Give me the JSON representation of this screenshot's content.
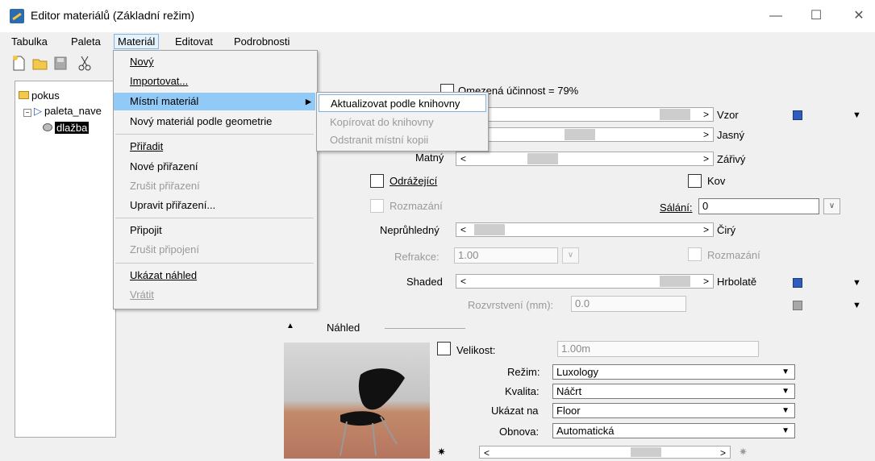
{
  "window": {
    "title": "Editor materiálů (Základní režim)",
    "minimize": "—",
    "maximize": "☐",
    "close": "✕"
  },
  "menubar": [
    "Tabulka",
    "Paleta",
    "Materiál",
    "Editovat",
    "Podrobnosti"
  ],
  "tree": {
    "root": "pokus",
    "palette": "paleta_nave",
    "material": "dlažba"
  },
  "material_menu": {
    "items": [
      "Nový",
      "Importovat...",
      "Místní materiál",
      "Nový materiál podle geometrie",
      "Přiřadit",
      "Nové přiřazení",
      "Zrušit přiřazení",
      "Upravit přiřazení...",
      "Připojit",
      "Zrušit připojení",
      "Ukázat náhled",
      "Vrátit"
    ],
    "disabled": [
      "Zrušit přiřazení",
      "Zrušit připojení",
      "Vrátit"
    ]
  },
  "submenu": {
    "items": [
      "Aktualizovat podle knihovny",
      "Kopírovat do knihovny",
      "Odstranit místní kopii"
    ]
  },
  "props": {
    "efficiency_label": "Omezená účinnost = 79%",
    "vzor": "Vzor",
    "jasny": "Jasný",
    "matny": "Matný",
    "zarivy": "Zářivý",
    "odrazejici": "Odrážející",
    "kov": "Kov",
    "rozmazani": "Rozmazání",
    "salani_label": "Sálání:",
    "salani_value": "0",
    "nepruhledny": "Neprůhledný",
    "ciry": "Čirý",
    "refrakce_label": "Refrakce:",
    "refrakce_value": "1.00",
    "rozmazani2": "Rozmazání",
    "shaded": "Shaded",
    "hrbolate": "Hrbolatě",
    "rozvrstveni_label": "Rozvrstvení (mm):",
    "rozvrstveni_value": "0.0",
    "lt": "<",
    "gt": ">"
  },
  "preview": {
    "title": "Náhled",
    "velikost_label": "Velikost:",
    "velikost_value": "1.00m",
    "rezim_label": "Režim:",
    "rezim_value": "Luxology",
    "kvalita_label": "Kvalita:",
    "kvalita_value": "Náčrt",
    "ukazat_label": "Ukázat na",
    "ukazat_value": "Floor",
    "obnova_label": "Obnova:",
    "obnova_value": "Automatická"
  }
}
